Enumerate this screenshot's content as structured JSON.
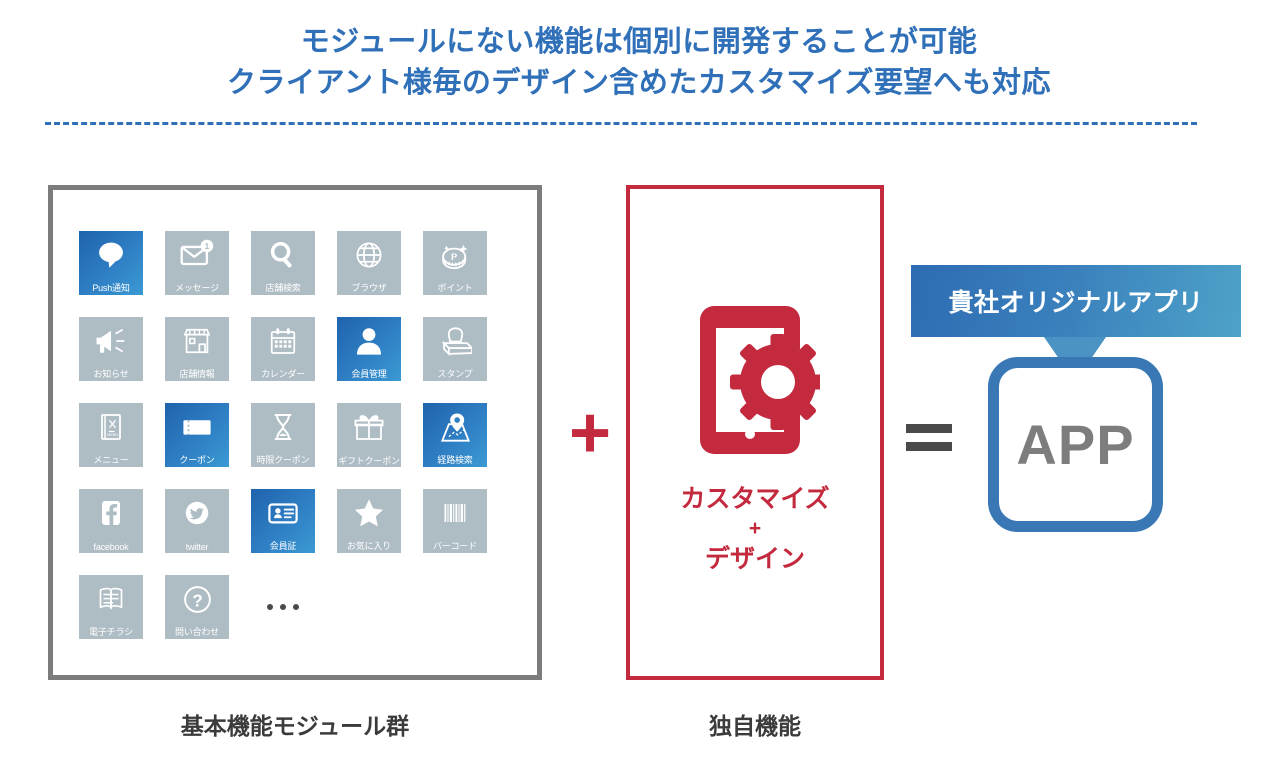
{
  "title": {
    "line1": "モジュールにない機能は個別に開発することが可能",
    "line2": "クライアント様毎のデザイン含めたカスタマイズ要望へも対応"
  },
  "colors": {
    "title_blue": "#3070b8",
    "divider_blue": "#3070b8",
    "tile_grey": "#aebcc4",
    "tile_active_blue": "#2f7fc4",
    "accent_red": "#c42a3e",
    "frame_grey": "#7c7c7c",
    "app_border_blue": "#3a78b5",
    "app_text_grey": "#7d7d7d",
    "equals_grey": "#4a4a4a"
  },
  "modules": {
    "caption": "基本機能モジュール群",
    "tiles": [
      {
        "label": "Push通知",
        "icon": "chat-bubble-icon",
        "active": true
      },
      {
        "label": "メッセージ",
        "icon": "mail-badge-icon",
        "active": false
      },
      {
        "label": "店舗検索",
        "icon": "magnifier-icon",
        "active": false
      },
      {
        "label": "ブラウザ",
        "icon": "globe-icon",
        "active": false
      },
      {
        "label": "ポイント",
        "icon": "point-coin-icon",
        "active": false
      },
      {
        "label": "お知らせ",
        "icon": "megaphone-icon",
        "active": false
      },
      {
        "label": "店舗情報",
        "icon": "storefront-icon",
        "active": false
      },
      {
        "label": "カレンダー",
        "icon": "calendar-icon",
        "active": false
      },
      {
        "label": "会員管理",
        "icon": "person-icon",
        "active": true
      },
      {
        "label": "スタンプ",
        "icon": "rubber-stamp-icon",
        "active": false
      },
      {
        "label": "メニュー",
        "icon": "menu-book-icon",
        "active": false
      },
      {
        "label": "クーポン",
        "icon": "ticket-icon",
        "active": true
      },
      {
        "label": "時限クーポン",
        "icon": "hourglass-icon",
        "active": false
      },
      {
        "label": "ギフトクーポン",
        "icon": "gift-box-icon",
        "active": false
      },
      {
        "label": "経路検索",
        "icon": "map-pin-icon",
        "active": true
      },
      {
        "label": "facebook",
        "icon": "facebook-icon",
        "active": false
      },
      {
        "label": "twitter",
        "icon": "twitter-bird-icon",
        "active": false
      },
      {
        "label": "会員証",
        "icon": "id-card-icon",
        "active": true
      },
      {
        "label": "お気に入り",
        "icon": "star-icon",
        "active": false
      },
      {
        "label": "バーコード",
        "icon": "barcode-icon",
        "active": false
      },
      {
        "label": "電子チラシ",
        "icon": "flyer-icon",
        "active": false
      },
      {
        "label": "問い合わせ",
        "icon": "question-mark-icon",
        "active": false
      }
    ],
    "more_indicator": "•••"
  },
  "operators": {
    "plus": "+",
    "equals": "="
  },
  "custom": {
    "caption": "独自機能",
    "icon": "phone-gear-icon",
    "text_main": "カスタマイズ",
    "text_plus": "+",
    "text_sub": "デザイン"
  },
  "result": {
    "banner": "貴社オリジナルアプリ",
    "app_label": "APP"
  }
}
